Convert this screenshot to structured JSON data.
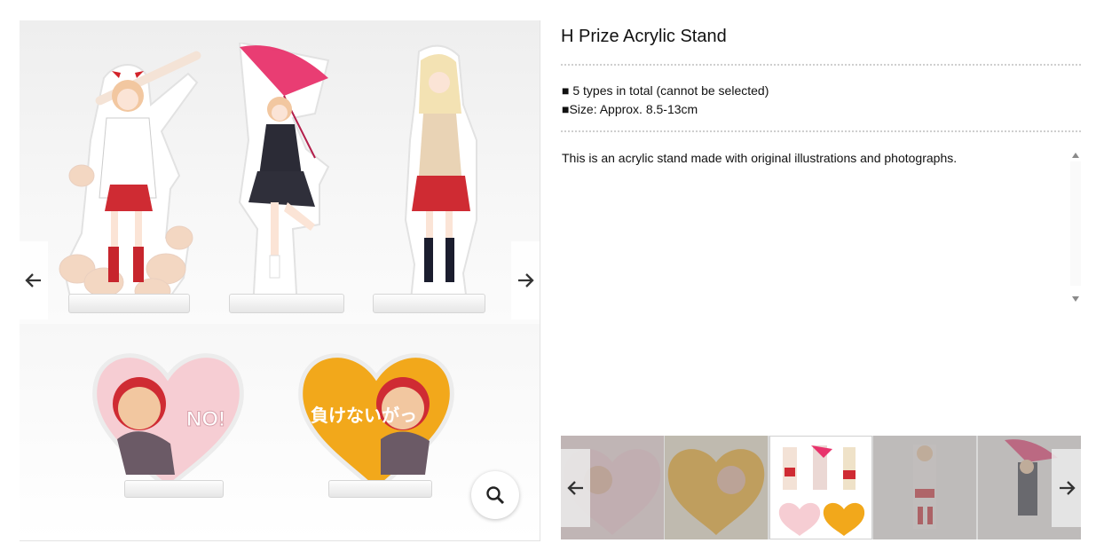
{
  "product": {
    "title": "H Prize Acrylic Stand",
    "specs": [
      "■ 5 types in total (cannot be selected)",
      "■Size: Approx. 8.5-13cm"
    ],
    "description": "This is an acrylic stand made with original illustrations and photographs."
  },
  "heart_texts": {
    "pink": "NO!",
    "orange": "負けないがっ"
  },
  "gallery": {
    "main_image_alt": "Acrylic stand product photo",
    "prev_icon": "arrow-left-icon",
    "next_icon": "arrow-right-icon",
    "zoom_icon": "magnifier-icon",
    "thumbnails": [
      {
        "name": "pink heart stand",
        "selected": false
      },
      {
        "name": "orange heart stand",
        "selected": false
      },
      {
        "name": "all five stands",
        "selected": true
      },
      {
        "name": "cardigan girl stand",
        "selected": false
      },
      {
        "name": "umbrella girl stand",
        "selected": false
      }
    ]
  },
  "colors": {
    "heart_pink": "#f6cdd3",
    "heart_orange": "#f2a81b",
    "skirt_red": "#cf2b33",
    "umbrella_pink": "#e8336c"
  }
}
